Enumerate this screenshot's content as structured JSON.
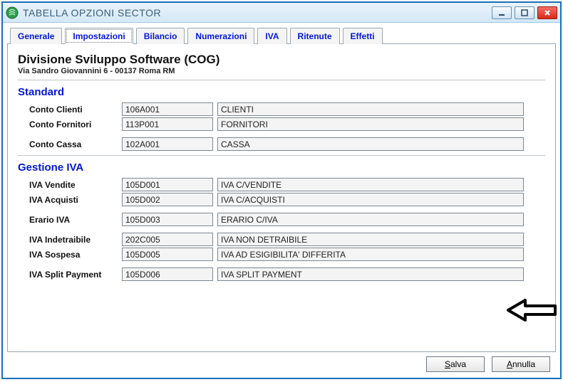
{
  "window": {
    "title": "TABELLA OPZIONI SECTOR"
  },
  "tabs": [
    {
      "label": "Generale"
    },
    {
      "label": "Impostazioni"
    },
    {
      "label": "Bilancio"
    },
    {
      "label": "Numerazioni"
    },
    {
      "label": "IVA"
    },
    {
      "label": "Ritenute"
    },
    {
      "label": "Effetti"
    }
  ],
  "org": {
    "title": "Divisione Sviluppo Software (COG)",
    "address": "Via Sandro Giovannini 6 - 00137 Roma RM"
  },
  "sections": {
    "standard": {
      "title": "Standard",
      "rows": [
        {
          "label": "Conto Clienti",
          "code": "106A001",
          "desc": "CLIENTI"
        },
        {
          "label": "Conto Fornitori",
          "code": "113P001",
          "desc": "FORNITORI"
        },
        {
          "label": "Conto Cassa",
          "code": "102A001",
          "desc": "CASSA"
        }
      ]
    },
    "iva": {
      "title": "Gestione IVA",
      "rows": [
        {
          "label": "IVA Vendite",
          "code": "105D001",
          "desc": "IVA C/VENDITE"
        },
        {
          "label": "IVA Acquisti",
          "code": "105D002",
          "desc": "IVA C/ACQUISTI"
        },
        {
          "label": "Erario IVA",
          "code": "105D003",
          "desc": "ERARIO C/IVA"
        },
        {
          "label": "IVA Indetraibile",
          "code": "202C005",
          "desc": "IVA NON DETRAIBILE"
        },
        {
          "label": "IVA Sospesa",
          "code": "105D005",
          "desc": "IVA AD ESIGIBILITA' DIFFERITA"
        },
        {
          "label": "IVA Split Payment",
          "code": "105D006",
          "desc": "IVA SPLIT PAYMENT"
        }
      ]
    }
  },
  "buttons": {
    "save_key": "S",
    "save_rest": "alva",
    "cancel_key": "A",
    "cancel_rest": "nnulla"
  }
}
